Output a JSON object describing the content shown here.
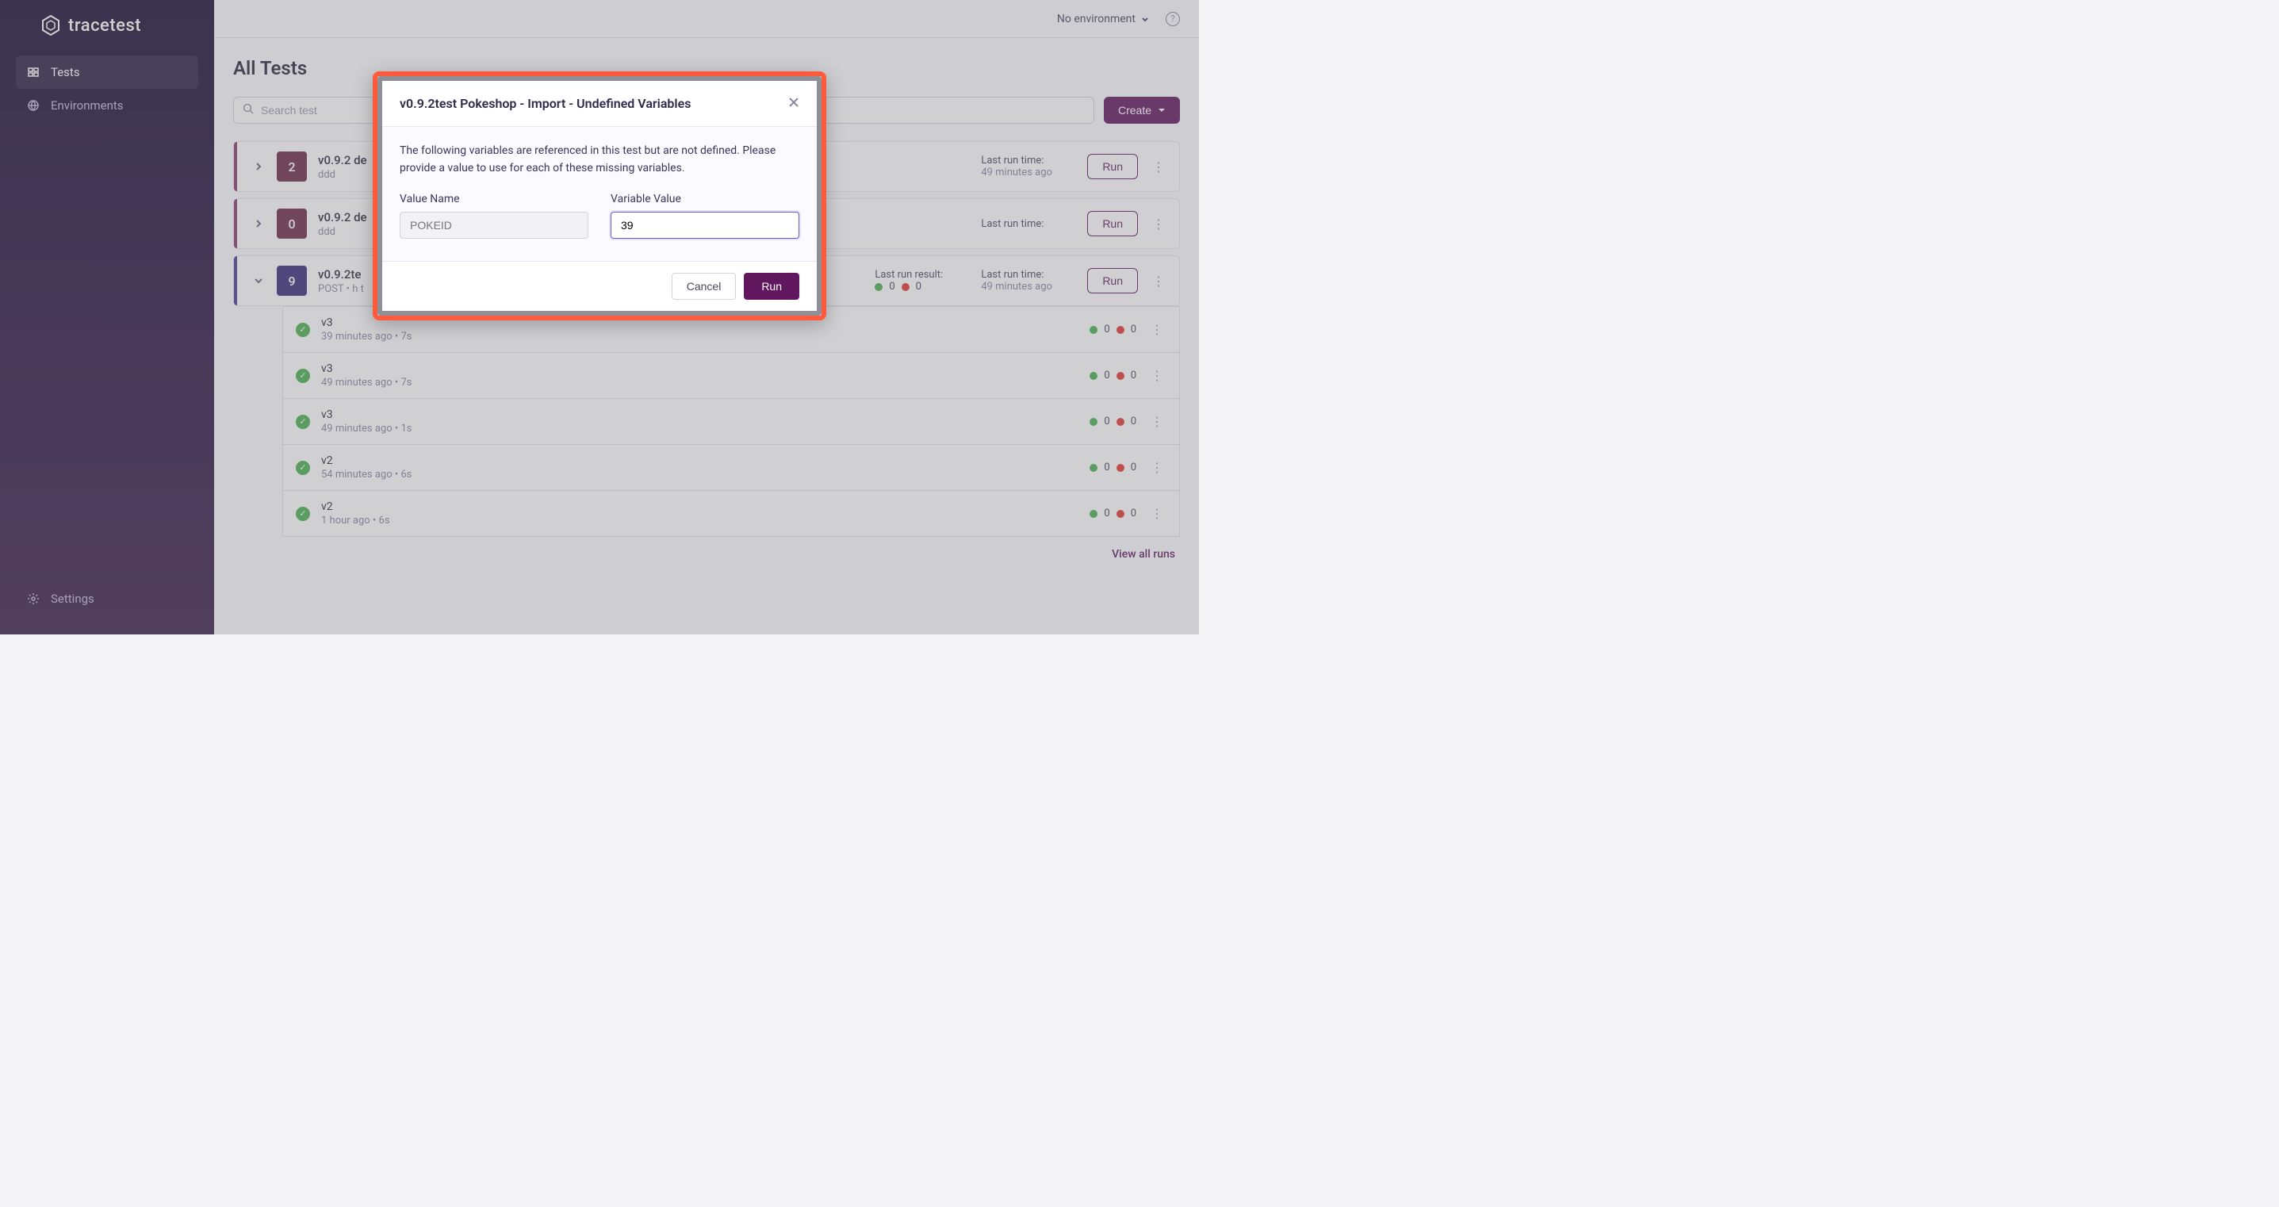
{
  "brand": "tracetest",
  "nav": {
    "tests": "Tests",
    "environments": "Environments",
    "settings": "Settings"
  },
  "topbar": {
    "env_label": "No environment"
  },
  "page": {
    "title": "All Tests",
    "search_placeholder": "Search test",
    "create_label": "Create"
  },
  "labels": {
    "last_run_time": "Last run time:",
    "last_run_result": "Last run result:",
    "run": "Run",
    "view_all": "View all runs"
  },
  "tests": [
    {
      "badge": "2",
      "badge_style": "red",
      "title": "v0.9.2 de",
      "sub": "ddd",
      "last_run_time": "49 minutes ago",
      "expanded": false
    },
    {
      "badge": "0",
      "badge_style": "red",
      "title": "v0.9.2 de",
      "sub": "ddd",
      "last_run_time": "",
      "expanded": false
    },
    {
      "badge": "9",
      "badge_style": "purple",
      "title": "v0.9.2te",
      "sub": "POST • h t",
      "last_run_time": "49 minutes ago",
      "result_pass": "0",
      "result_fail": "0",
      "expanded": true,
      "runs": [
        {
          "v": "v3",
          "sub": "39 minutes ago • 7s",
          "pass": "0",
          "fail": "0"
        },
        {
          "v": "v3",
          "sub": "49 minutes ago • 7s",
          "pass": "0",
          "fail": "0"
        },
        {
          "v": "v3",
          "sub": "49 minutes ago • 1s",
          "pass": "0",
          "fail": "0"
        },
        {
          "v": "v2",
          "sub": "54 minutes ago • 6s",
          "pass": "0",
          "fail": "0"
        },
        {
          "v": "v2",
          "sub": "1 hour ago • 6s",
          "pass": "0",
          "fail": "0"
        }
      ]
    }
  ],
  "modal": {
    "title": "v0.9.2test Pokeshop - Import - Undefined Variables",
    "description": "The following variables are referenced in this test but are not defined. Please provide a value to use for each of these missing variables.",
    "col_name_label": "Value Name",
    "col_value_label": "Variable Value",
    "name_placeholder": "POKEID",
    "value_input": "39",
    "cancel": "Cancel",
    "run": "Run"
  }
}
